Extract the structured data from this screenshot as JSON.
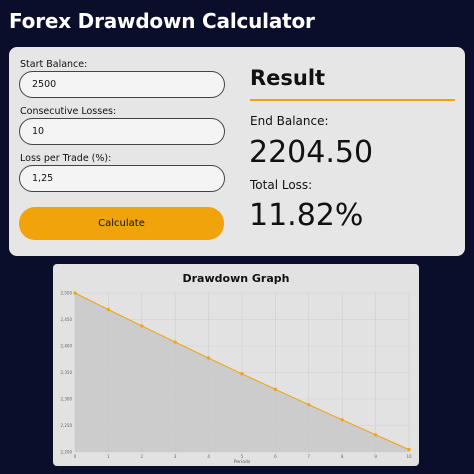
{
  "app": {
    "title": "Forex Drawdown Calculator"
  },
  "form": {
    "start_balance": {
      "label": "Start Balance:",
      "value": "2500"
    },
    "consecutive_losses": {
      "label": "Consecutive Losses:",
      "value": "10"
    },
    "loss_per_trade": {
      "label": "Loss per Trade (%):",
      "value": "1,25"
    },
    "calculate_label": "Calculate"
  },
  "result": {
    "title": "Result",
    "end_balance_label": "End Balance:",
    "end_balance_value": "2204.50",
    "total_loss_label": "Total Loss:",
    "total_loss_value": "11.82%"
  },
  "colors": {
    "background": "#0a0e2a",
    "card": "#e6e6e6",
    "accent": "#f0a30a",
    "area_fill": "#c8c8c8"
  },
  "chart_data": {
    "type": "line",
    "title": "Drawdown Graph",
    "xlabel": "Periods",
    "ylabel": "",
    "x": [
      0,
      1,
      2,
      3,
      4,
      5,
      6,
      7,
      8,
      9,
      10
    ],
    "series": [
      {
        "values": [
          2500,
          2468.75,
          2437.89,
          2407.42,
          2377.32,
          2347.61,
          2318.26,
          2289.28,
          2260.67,
          2232.41,
          2204.5
        ]
      }
    ],
    "ylim": [
      2200,
      2500
    ],
    "yticks": [
      2500,
      2450,
      2400,
      2350,
      2300,
      2250,
      2200
    ],
    "ytick_labels": [
      "2,500",
      "2,450",
      "2,400",
      "2,350",
      "2,300",
      "2,250",
      "2,200"
    ],
    "xticks": [
      0,
      1,
      2,
      3,
      4,
      5,
      6,
      7,
      8,
      9,
      10
    ],
    "grid": true,
    "fill": "area"
  }
}
